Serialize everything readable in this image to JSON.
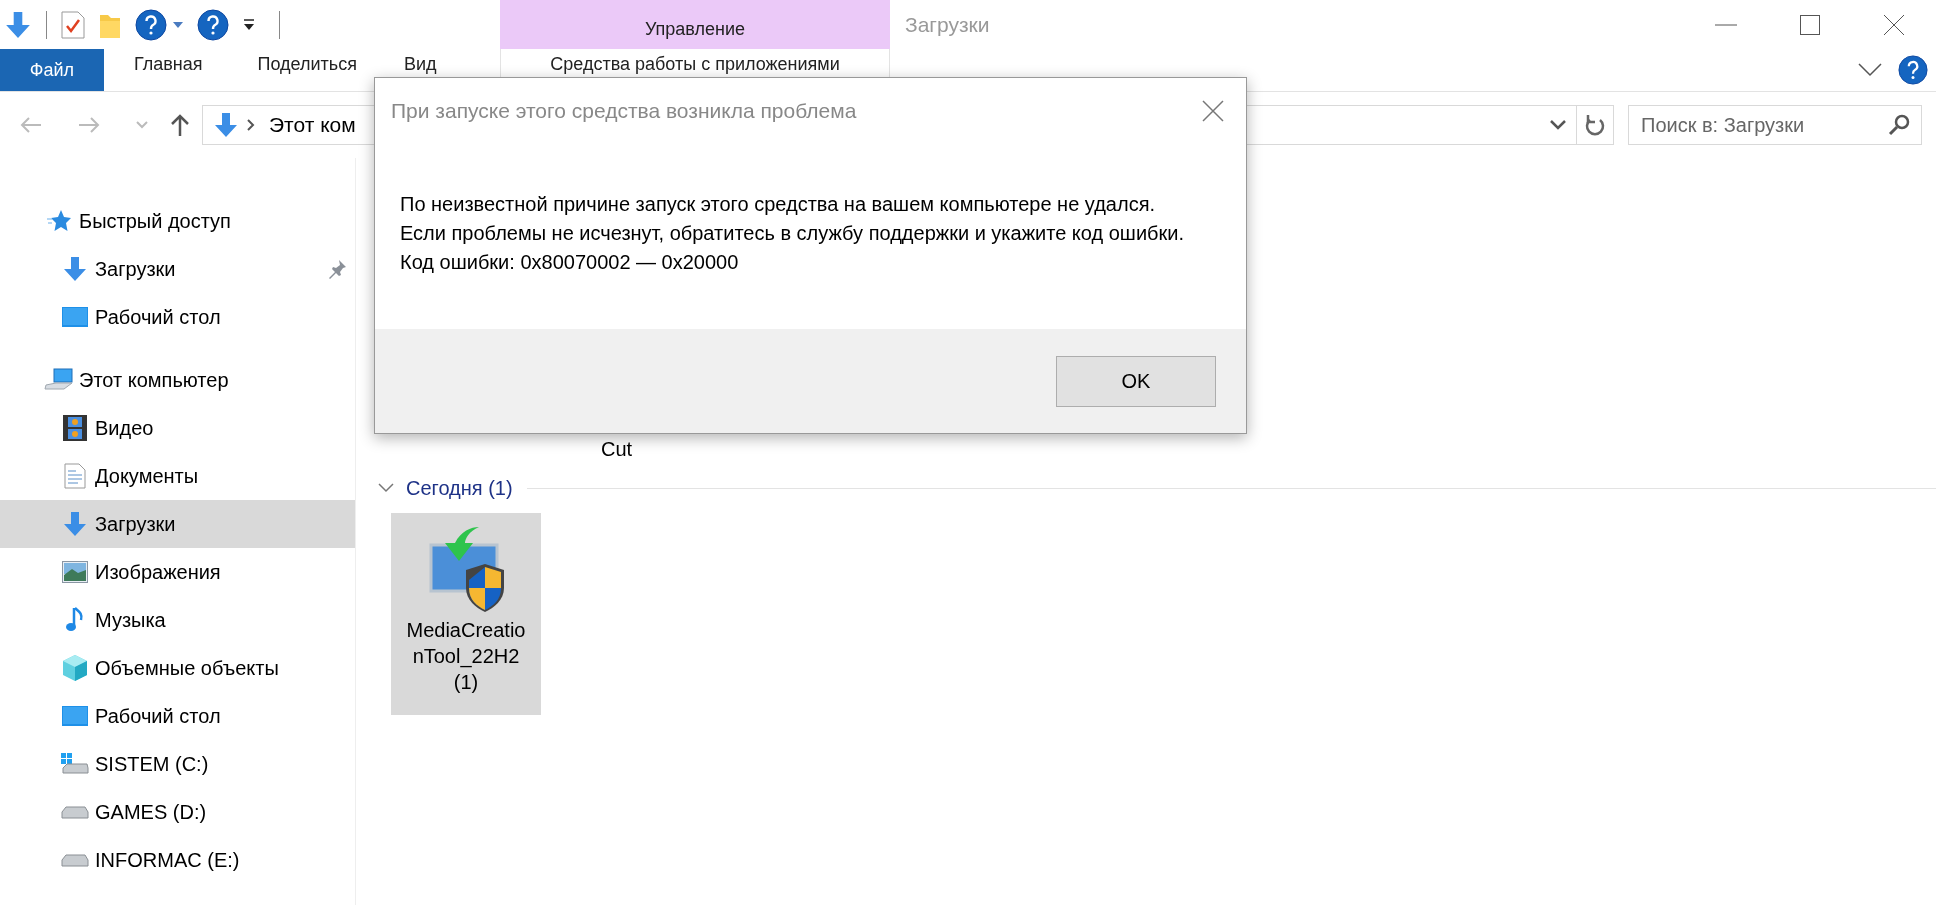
{
  "window": {
    "title": "Загрузки"
  },
  "ribbon": {
    "file_tab": "Файл",
    "tabs": [
      "Главная",
      "Поделиться",
      "Вид"
    ],
    "context_group": "Управление",
    "context_tab": "Средства работы с приложениями"
  },
  "address_bar": {
    "path": "Этот ком"
  },
  "search": {
    "placeholder": "Поиск в: Загрузки"
  },
  "sidebar": [
    {
      "label": "Быстрый доступ",
      "kind": "star",
      "selected": false,
      "pinned": false,
      "children": [
        {
          "label": "Загрузки",
          "kind": "download",
          "selected": false,
          "pinned": true
        },
        {
          "label": "Рабочий стол",
          "kind": "desktop",
          "selected": false,
          "pinned": false
        }
      ]
    },
    {
      "label": "Этот компьютер",
      "kind": "computer",
      "selected": false,
      "pinned": false,
      "children": [
        {
          "label": "Видео",
          "kind": "video",
          "selected": false,
          "pinned": false
        },
        {
          "label": "Документы",
          "kind": "document",
          "selected": false,
          "pinned": false
        },
        {
          "label": "Загрузки",
          "kind": "download",
          "selected": true,
          "pinned": false
        },
        {
          "label": "Изображения",
          "kind": "pictures",
          "selected": false,
          "pinned": false
        },
        {
          "label": "Музыка",
          "kind": "music",
          "selected": false,
          "pinned": false
        },
        {
          "label": "Объемные объекты",
          "kind": "cube",
          "selected": false,
          "pinned": false
        },
        {
          "label": "Рабочий стол",
          "kind": "desktop",
          "selected": false,
          "pinned": false
        },
        {
          "label": "SISTEM (C:)",
          "kind": "system_drive",
          "selected": false,
          "pinned": false
        },
        {
          "label": "GAMES (D:)",
          "kind": "drive",
          "selected": false,
          "pinned": false
        },
        {
          "label": "INFORMAC (E:)",
          "kind": "drive",
          "selected": false,
          "pinned": false
        }
      ]
    }
  ],
  "content": {
    "hidden_item_label": "Cut",
    "groups": [
      {
        "title": "Сегодня (1)",
        "expanded": true,
        "files": [
          {
            "name": "MediaCreationTool_22H2 (1)",
            "selected": true
          }
        ]
      }
    ]
  },
  "dialog": {
    "title": "При запуске этого средства возникла проблема",
    "message": "По неизвестной причине запуск этого средства на вашем компьютере не удался. Если проблемы не исчезнут, обратитесь в службу поддержки и укажите код ошибки. Код ошибки: 0x80070002 — 0x20000",
    "button": "OK"
  }
}
